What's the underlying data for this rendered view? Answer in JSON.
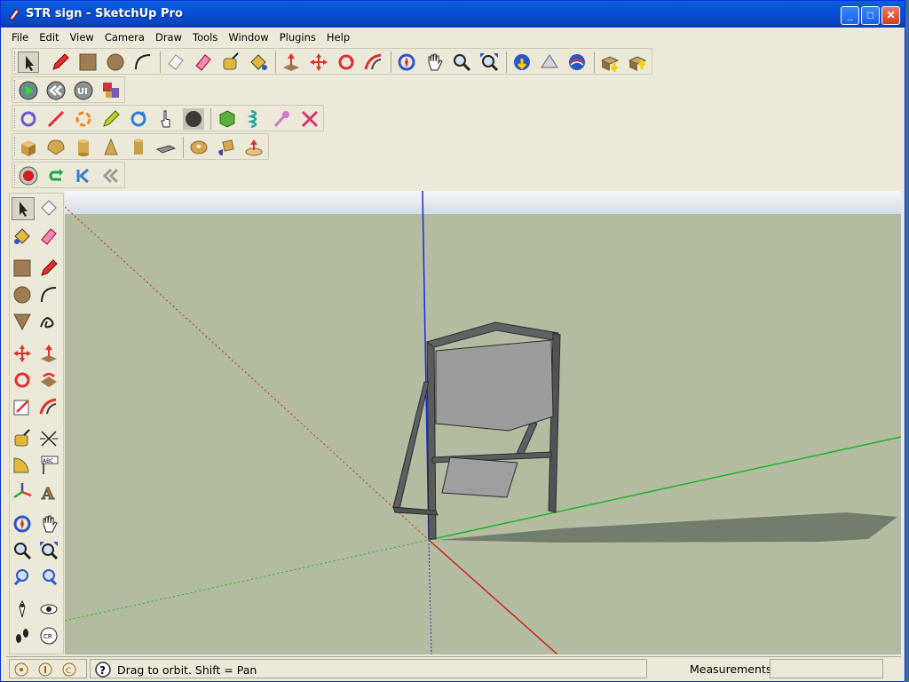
{
  "window": {
    "title": "STR sign - SketchUp Pro",
    "minimize": "_",
    "maximize": "□",
    "close": "✕"
  },
  "menu": [
    "File",
    "Edit",
    "View",
    "Camera",
    "Draw",
    "Tools",
    "Window",
    "Plugins",
    "Help"
  ],
  "toolbars": {
    "row1": [
      "select-icon",
      "pencil-icon",
      "rectangle-icon",
      "circle-icon",
      "arc-icon",
      "eraser-icon",
      "eraser-pink-icon",
      "tape-measure-icon",
      "paint-bucket-icon",
      "push-pull-icon",
      "move-icon",
      "rotate-icon",
      "follow-me-icon",
      "orbit-icon",
      "pan-icon",
      "zoom-icon",
      "zoom-extents-icon",
      "get-models-icon",
      "share-model-icon",
      "google-earth-icon",
      "import-component-icon",
      "export-component-icon"
    ],
    "row2": [
      "play-icon",
      "rewind-icon",
      "ui-icon",
      "ruby-console-icon"
    ],
    "row3": [
      "orbit-blue-icon",
      "line-icon",
      "rotate-orange-icon",
      "pencil-green-icon",
      "refresh-icon",
      "hand-pointer-icon",
      "black-circle-icon",
      "green-sphere-icon",
      "spring-icon",
      "pin-icon",
      "cross-icon"
    ],
    "row4": [
      "box-icon",
      "dome-icon",
      "cylinder-icon",
      "cone-icon",
      "tube-icon",
      "plate-icon",
      "donut-icon",
      "shape-icon",
      "push-shape-icon"
    ],
    "row5": [
      "record-icon",
      "loop-icon",
      "first-frame-icon",
      "previous-icon"
    ]
  },
  "status": {
    "message": "Drag to orbit.  Shift = Pan",
    "measurements_label": "Measurements",
    "measurements_value": ""
  },
  "colors": {
    "sky": "#dfe6ee",
    "ground": "#b3bca1",
    "axis_blue": "#1d2be0",
    "axis_red": "#c8281e",
    "axis_green": "#19b62a",
    "sign": "#9c9c9c"
  }
}
